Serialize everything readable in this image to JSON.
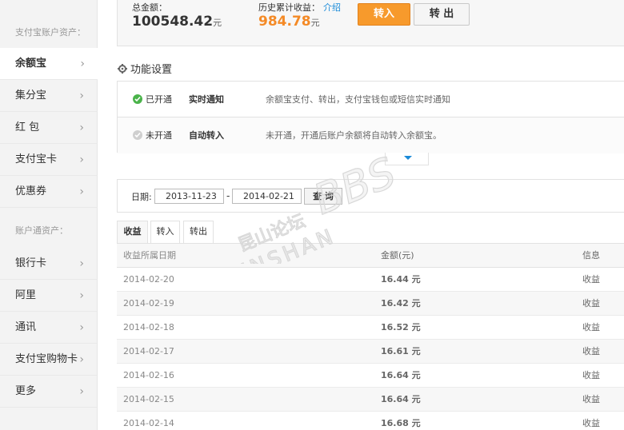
{
  "sidebar": {
    "section1": "支付宝账户资产：",
    "items1": [
      {
        "label": "余额宝",
        "active": true
      },
      {
        "label": "集分宝"
      },
      {
        "label": "红 包"
      },
      {
        "label": "支付宝卡"
      },
      {
        "label": "优惠券"
      }
    ],
    "section2": "账户通资产：",
    "items2": [
      {
        "label": "银行卡"
      },
      {
        "label": "阿里"
      },
      {
        "label": "通讯"
      },
      {
        "label": "支付宝购物卡"
      },
      {
        "label": "更多"
      }
    ],
    "chevron": "›"
  },
  "summary": {
    "total_label": "总金额：",
    "total_value": "100548.42",
    "total_unit": "元",
    "history_label": "历史累计收益：",
    "history_link": "介绍",
    "history_value": "984.78",
    "history_unit": "元",
    "btn_in": "转入",
    "btn_out": "转 出"
  },
  "features": {
    "title": "功能设置",
    "rows": [
      {
        "status": "已开通",
        "name": "实时通知",
        "desc": "余额宝支付、转出，支付宝钱包或短信实时通知"
      },
      {
        "status": "未开通",
        "name": "自动转入",
        "desc": "未开通，开通后账户余额将自动转入余额宝。"
      }
    ]
  },
  "filter": {
    "date_label": "日期:",
    "start_date": "2013-11-23",
    "dash": "-",
    "end_date": "2014-02-21",
    "query_label": "查 询"
  },
  "tabs": [
    "收益",
    "转入",
    "转出"
  ],
  "table": {
    "headers": {
      "date": "收益所属日期",
      "amount": "金额(元)",
      "info": "信息"
    },
    "rows": [
      {
        "date": "2014-02-20",
        "amount": "16.44 元",
        "info": "收益"
      },
      {
        "date": "2014-02-19",
        "amount": "16.42 元",
        "info": "收益"
      },
      {
        "date": "2014-02-18",
        "amount": "16.52 元",
        "info": "收益"
      },
      {
        "date": "2014-02-17",
        "amount": "16.61 元",
        "info": "收益"
      },
      {
        "date": "2014-02-16",
        "amount": "16.64 元",
        "info": "收益"
      },
      {
        "date": "2014-02-15",
        "amount": "16.64 元",
        "info": "收益"
      },
      {
        "date": "2014-02-14",
        "amount": "16.68 元",
        "info": "收益"
      }
    ]
  },
  "watermark": {
    "text1": "昆山论坛",
    "text2": "KUNSHAN",
    "text3": "BBS"
  },
  "colors": {
    "accent_orange": "#f79a2c",
    "link_blue": "#1a8ad8",
    "history_orange": "#f48a26",
    "on_green": "#4ab34a"
  }
}
